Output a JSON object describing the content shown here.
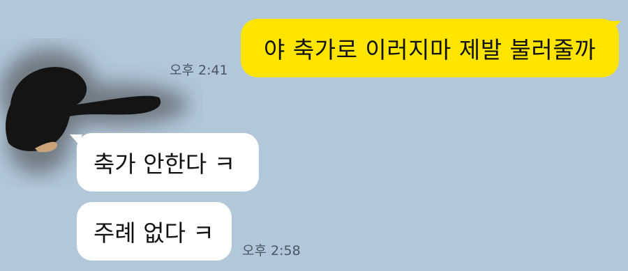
{
  "messages": [
    {
      "direction": "sent",
      "text": "야 축가로 이러지마 제발 불러줄까",
      "time": "오후 2:41"
    },
    {
      "direction": "received",
      "text": "축가 안한다 ㅋ"
    },
    {
      "direction": "received",
      "text": "주례 없다 ㅋ",
      "time": "오후 2:58"
    }
  ],
  "colors": {
    "background": "#b2c7da",
    "sent_bubble": "#fee500",
    "received_bubble": "#ffffff",
    "timestamp": "#4a5563"
  },
  "avatar": {
    "icon": "redacted-avatar-icon"
  }
}
